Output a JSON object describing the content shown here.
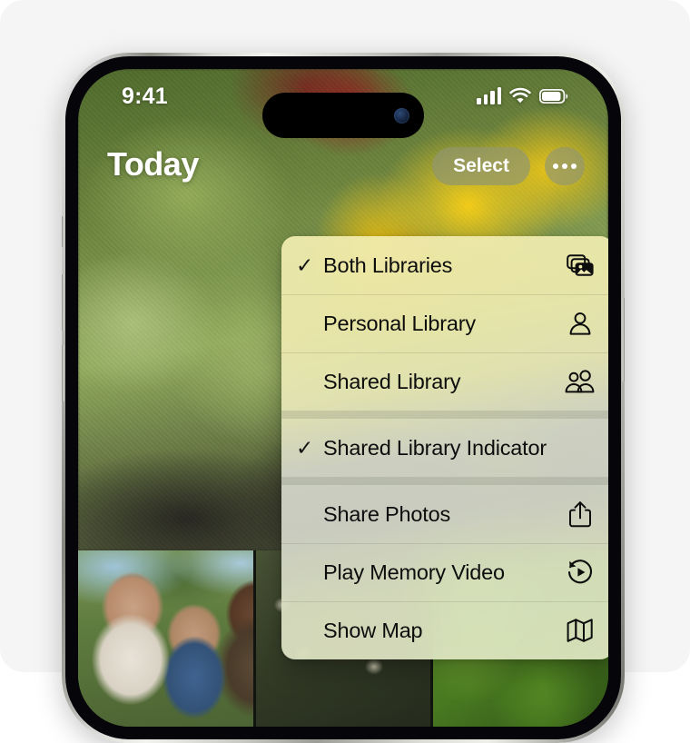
{
  "device": {
    "name": "iPhone",
    "buttons": [
      "silent-switch",
      "volume-up",
      "volume-down",
      "power"
    ]
  },
  "status_bar": {
    "time": "9:41",
    "cellular_icon": "cellular-bars-icon",
    "cellular_bars": 4,
    "wifi_icon": "wifi-icon",
    "battery_icon": "battery-icon",
    "battery_level_percent": 82
  },
  "nav_bar": {
    "title": "Today",
    "select_label": "Select",
    "more_icon": "ellipsis-icon"
  },
  "context_menu": {
    "groups": [
      {
        "name": "library-scope",
        "items": [
          {
            "label": "Both Libraries",
            "checked": true,
            "check_glyph": "✓",
            "icon": "photo-stack-icon"
          },
          {
            "label": "Personal Library",
            "checked": false,
            "check_glyph": "",
            "icon": "person-icon"
          },
          {
            "label": "Shared Library",
            "checked": false,
            "check_glyph": "",
            "icon": "two-people-icon"
          }
        ]
      },
      {
        "name": "indicator-toggle",
        "items": [
          {
            "label": "Shared Library Indicator",
            "checked": true,
            "check_glyph": "✓",
            "icon": ""
          }
        ]
      },
      {
        "name": "actions",
        "items": [
          {
            "label": "Share Photos",
            "checked": false,
            "check_glyph": "",
            "icon": "share-icon"
          },
          {
            "label": "Play Memory Video",
            "checked": false,
            "check_glyph": "",
            "icon": "memory-video-icon"
          },
          {
            "label": "Show Map",
            "checked": false,
            "check_glyph": "",
            "icon": "map-icon"
          }
        ]
      }
    ]
  },
  "colors": {
    "page_background": "#ffffff",
    "card_background": "#f5f5f5",
    "menu_text": "#0d0d0d",
    "nav_text": "#ffffff",
    "control_chip": "rgba(140,148,120,.62)"
  },
  "photo_grid": {
    "cells": [
      "people-photo",
      "flowers-photo",
      "leaf-photo"
    ]
  }
}
